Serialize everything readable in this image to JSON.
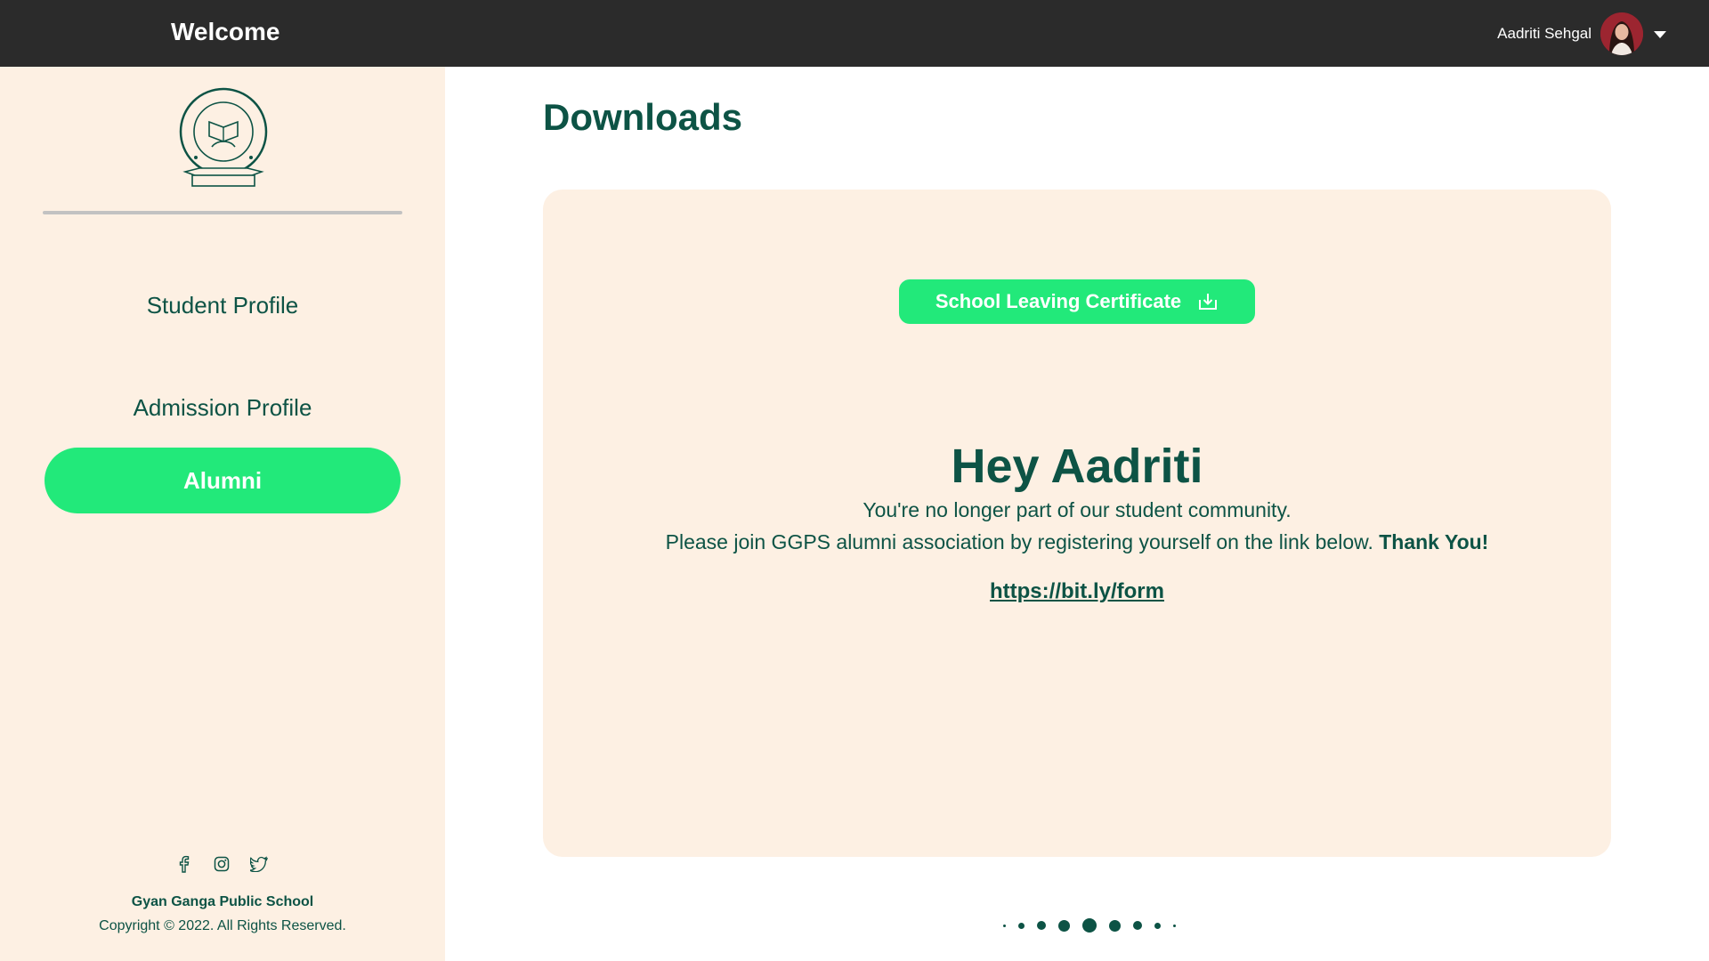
{
  "header": {
    "title": "Welcome",
    "user_name": "Aadriti Sehgal"
  },
  "sidebar": {
    "logo_text": "Gyan Ganga Public School",
    "items": [
      {
        "label": "Student Profile",
        "active": false
      },
      {
        "label": "Admission Profile",
        "active": false
      },
      {
        "label": "Alumni",
        "active": true
      }
    ],
    "social_icons": [
      "facebook-icon",
      "instagram-icon",
      "twitter-icon"
    ],
    "school_name": "Gyan Ganga Public School",
    "copyright": "Copyright © 2022. All Rights Reserved."
  },
  "main": {
    "page_title": "Downloads",
    "certificate_button": "School Leaving Certificate",
    "greeting": "Hey Aadriti",
    "message_line1": "You're no longer part of our student community.",
    "message_line2": "Please join GGPS alumni association by registering yourself on the link below.",
    "message_thanks": "Thank You!",
    "link_text": "https://bit.ly/form"
  },
  "colors": {
    "topbar": "#2b2b2b",
    "sidebar_bg": "#fdf0e3",
    "accent_green": "#22e97a",
    "text_dark_green": "#0d5345"
  },
  "loader": {
    "icon": "loading-dots-icon"
  }
}
